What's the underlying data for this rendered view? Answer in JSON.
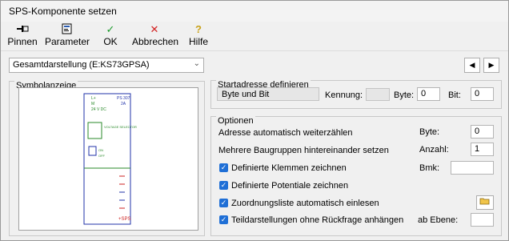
{
  "window": {
    "title": "SPS-Komponente setzen"
  },
  "toolbar": {
    "items": [
      {
        "label": "Pinnen",
        "icon": "pin-icon"
      },
      {
        "label": "Parameter",
        "icon": "parameter-icon"
      },
      {
        "label": "OK",
        "icon": "check-icon"
      },
      {
        "label": "Abbrechen",
        "icon": "cancel-icon"
      },
      {
        "label": "Hilfe",
        "icon": "help-icon"
      }
    ]
  },
  "view_select": {
    "value": "Gesamtdarstellung (E:KS73GPSA)"
  },
  "symbol": {
    "title": "Symbolanzeige",
    "preview": {
      "header_lines": [
        "PS 307",
        "2A"
      ],
      "io_labels": [
        "L+",
        "M",
        "24 V DC",
        "VOLTAGE SELECTOR",
        "ON",
        "OFF"
      ],
      "bottom_label": "+SPS"
    }
  },
  "start": {
    "title": "Startadresse definieren",
    "mode": "Byte und Bit",
    "kennung_label": "Kennung:",
    "kennung_value": "",
    "byte_label": "Byte:",
    "byte_value": "0",
    "bit_label": "Bit:",
    "bit_value": "0"
  },
  "options": {
    "title": "Optionen",
    "auto_count": "Adresse automatisch weiterzählen",
    "byte_label": "Byte:",
    "byte_value": "0",
    "multiple": "Mehrere Baugruppen hintereinander setzen",
    "count_label": "Anzahl:",
    "count_value": "1",
    "terminals": "Definierte Klemmen zeichnen",
    "bmk_label": "Bmk:",
    "bmk_value": "",
    "potentials": "Definierte Potentiale zeichnen",
    "assignment": "Zuordnungsliste automatisch einlesen",
    "partial": "Teildarstellungen ohne Rückfrage anhängen",
    "level_label": "ab Ebene:",
    "level_value": ""
  }
}
